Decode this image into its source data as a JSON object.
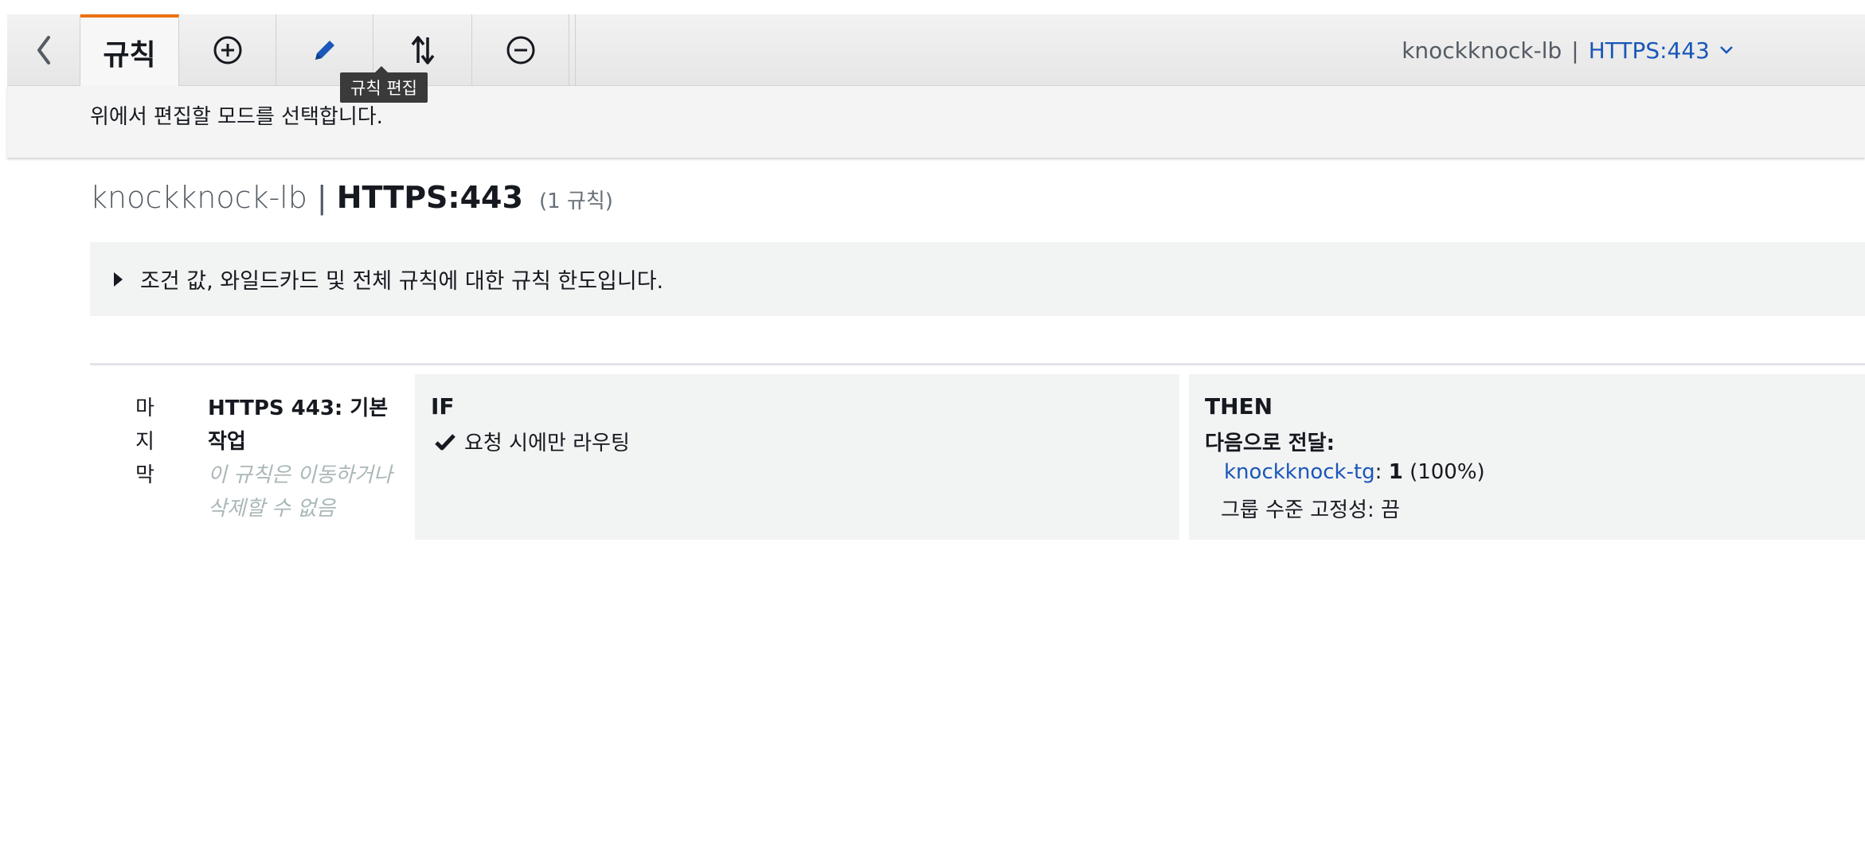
{
  "toolbar": {
    "back_icon": "chevron-left-icon",
    "rules_tab_label": "규칙",
    "add_icon": "plus-circle-icon",
    "edit_icon": "pencil-icon",
    "sort_icon": "sort-arrows-icon",
    "remove_icon": "minus-circle-icon",
    "edit_tooltip": "규칙 편집",
    "listener_selector": {
      "load_balancer": "knockknock-lb",
      "separator": "|",
      "listener": "HTTPS:443",
      "chevron_icon": "chevron-down-icon"
    },
    "accent_color": "#ec7211"
  },
  "mode_bar": {
    "message": "위에서 편집할 모드를 선택합니다."
  },
  "header": {
    "load_balancer": "knockknock-lb",
    "separator": "|",
    "listener": "HTTPS:443",
    "rule_count": "(1 규칙)"
  },
  "limits_panel": {
    "text": "조건 값, 와일드카드 및 전체 규칙에 대한 규칙 한도입니다."
  },
  "rules": [
    {
      "priority": "마지막",
      "name": "HTTPS 443: 기본 작업",
      "note": "이 규칙은 이동하거나 삭제할 수 없음",
      "if_label": "IF",
      "condition": "요청 시에만 라우팅",
      "then_label": "THEN",
      "forward_label": "다음으로 전달:",
      "target_group": "knockknock-tg",
      "target_sep": ":",
      "weight": "1",
      "weight_pct": "(100%)",
      "stickiness": "그룹 수준 고정성: 끔"
    }
  ],
  "colors": {
    "link": "#1a57b8",
    "panel_bg": "#f2f3f3"
  }
}
